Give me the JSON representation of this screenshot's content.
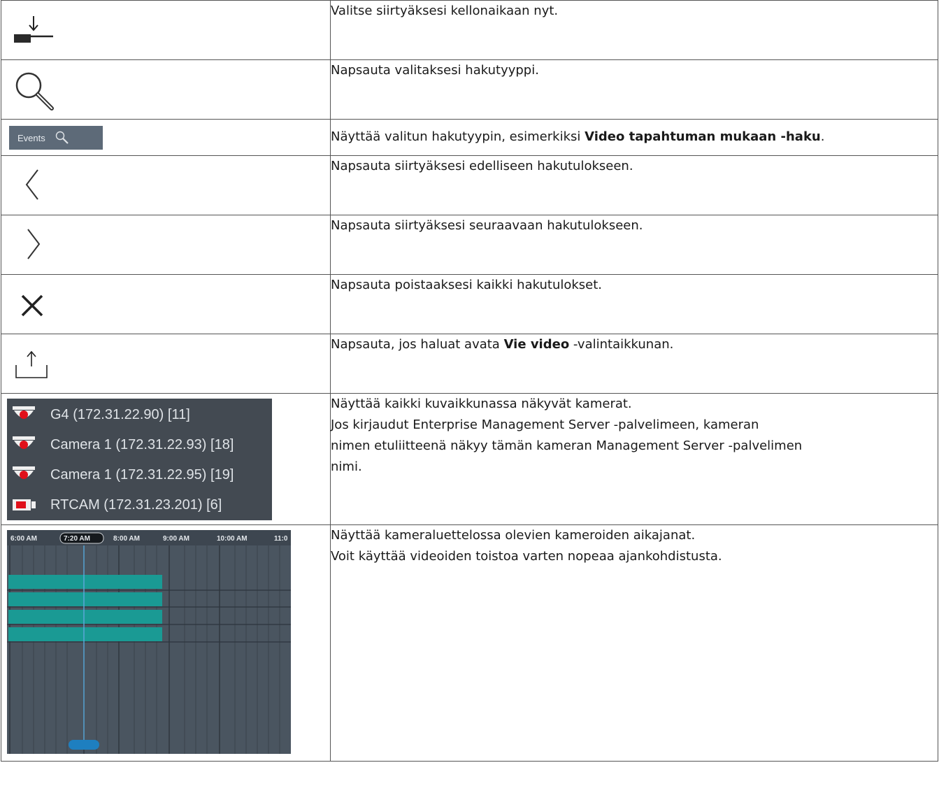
{
  "rows": [
    {
      "id": "goto-now",
      "icon": "jump-to-now-icon",
      "text": "Valitse siirtyäksesi kellonaikaan nyt."
    },
    {
      "id": "search-type",
      "icon": "search-icon",
      "text": "Napsauta valitaksesi hakutyyppi."
    },
    {
      "id": "selected-search",
      "icon": "events-search-button",
      "events_label": "Events",
      "text_before": "Näyttää valitun hakutyypin, esimerkiksi ",
      "text_bold": "Video tapahtuman mukaan -haku",
      "text_after": "."
    },
    {
      "id": "prev-result",
      "icon": "chevron-left-icon",
      "text": "Napsauta siirtyäksesi edelliseen hakutulokseen."
    },
    {
      "id": "next-result",
      "icon": "chevron-right-icon",
      "text": "Napsauta siirtyäksesi seuraavaan hakutulokseen."
    },
    {
      "id": "clear-results",
      "icon": "close-icon",
      "text": "Napsauta poistaaksesi kaikki hakutulokset."
    },
    {
      "id": "export",
      "icon": "export-icon",
      "text_before": "Napsauta, jos haluat avata ",
      "text_bold": "Vie video",
      "text_after": " -valintaikkunan."
    },
    {
      "id": "camera-list",
      "icon": "camera-list",
      "cameras": [
        {
          "name": "G4 (172.31.22.90) [11]",
          "icon": "dome-camera-icon"
        },
        {
          "name": "Camera 1 (172.31.22.93) [18]",
          "icon": "dome-camera-icon"
        },
        {
          "name": "Camera 1 (172.31.22.95) [19]",
          "icon": "dome-camera-icon"
        },
        {
          "name": "RTCAM (172.31.23.201) [6]",
          "icon": "box-camera-icon"
        }
      ],
      "lines": [
        "Näyttää kaikki kuvaikkunassa näkyvät kamerat.",
        "Jos kirjaudut Enterprise Management Server -palvelimeen, kameran",
        "nimen etuliitteenä näkyy tämän kameran Management Server -palvelimen",
        "nimi."
      ]
    },
    {
      "id": "timelines",
      "icon": "timeline-view",
      "time_labels": [
        "6:00 AM",
        "7:20 AM",
        "8:00 AM",
        "9:00 AM",
        "10:00 AM",
        "11:0"
      ],
      "current_time": "7:20 AM",
      "lines": [
        "Näyttää kameraluettelossa olevien kameroiden aikajanat.",
        "Voit käyttää videoiden toistoa varten nopeaa ajankohdistusta."
      ]
    }
  ],
  "colors": {
    "border": "#555555",
    "panel_bg": "#434a52",
    "timeline_bg": "#4a5560",
    "recording_bar": "#1a9a94",
    "camera_red": "#e0101a",
    "cursor_line": "#5aa8d8"
  }
}
